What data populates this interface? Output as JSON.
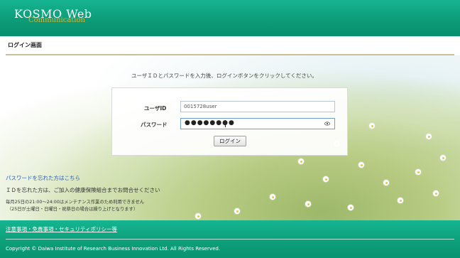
{
  "header": {
    "logo_main": "KOSMO Web",
    "logo_sub": "Communication"
  },
  "page": {
    "title": "ログイン画面",
    "instruction": "ユーザＩＤとパスワードを入力後、ログインボタンをクリックしてください。"
  },
  "login_form": {
    "userid_label": "ユーザID",
    "userid_value": "0015728user",
    "password_label": "パスワード",
    "password_mask": "●●●●●●●●",
    "login_button": "ログイン"
  },
  "help": {
    "forgot_password_link": "パスワードを忘れた方はこちら",
    "forgot_id_text": "ＩＤを忘れた方は、ご加入の健康保険組合までお問合せください",
    "maintenance_line1": "毎月25日の21:00～24:00はメンテナンス作業のため利用できません",
    "maintenance_line2": "（25日が土曜日・日曜日・祝祭日の場合は繰り上げとなります）"
  },
  "footer": {
    "policy_link": "注意事項・免責事項・セキュリティポリシー等",
    "copyright": "Copyright © Daiwa Institute of Research Business Innovation Ltd. All Rights Reserved."
  },
  "colors": {
    "brand_green": "#0c9c78",
    "logo_gold": "#e0b12a",
    "link_blue": "#2a5db0"
  }
}
